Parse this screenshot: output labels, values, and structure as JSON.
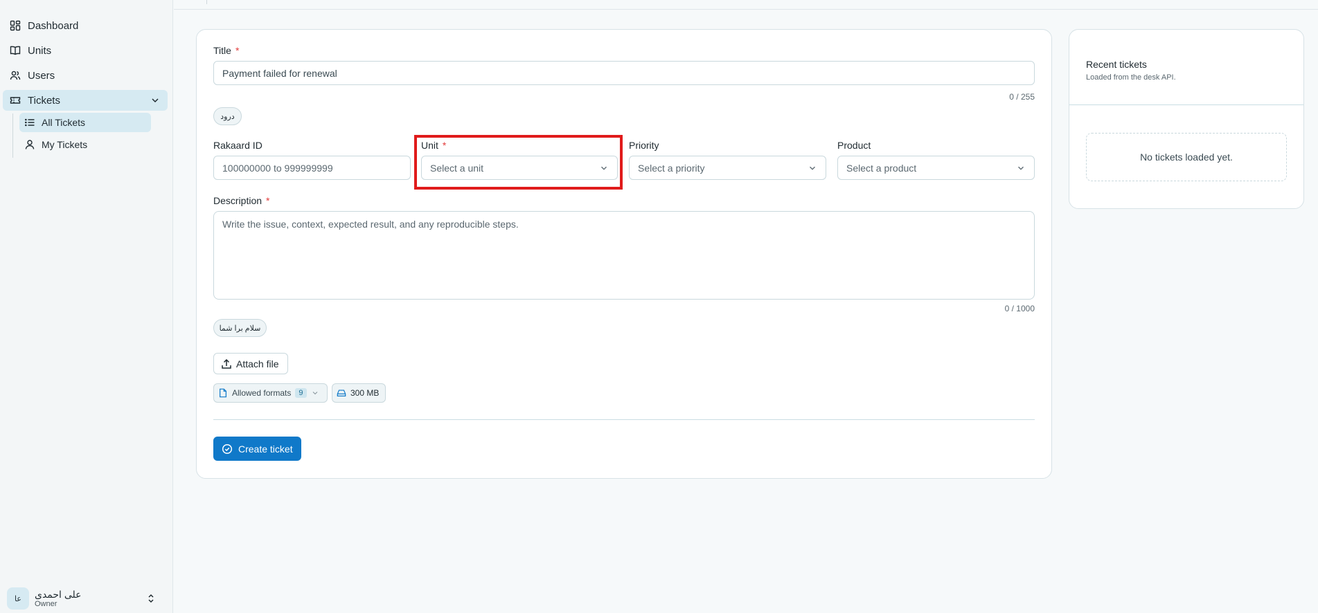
{
  "sidebar": {
    "items": [
      {
        "label": "Dashboard",
        "icon": "dashboard-icon"
      },
      {
        "label": "Units",
        "icon": "book-icon"
      },
      {
        "label": "Users",
        "icon": "users-icon"
      },
      {
        "label": "Tickets",
        "icon": "ticket-icon"
      }
    ],
    "sub_items": [
      {
        "label": "All Tickets",
        "icon": "list-icon"
      },
      {
        "label": "My Tickets",
        "icon": "user-icon"
      }
    ],
    "user": {
      "initials": "عا",
      "name": "علی احمدی",
      "role": "Owner"
    }
  },
  "form": {
    "title_label": "Title",
    "title_value": "Payment failed for renewal",
    "title_counter": "0 / 255",
    "title_chip": "درود",
    "rakaard_label": "Rakaard ID",
    "rakaard_placeholder": "100000000 to 999999999",
    "unit_label": "Unit",
    "unit_placeholder": "Select a unit",
    "priority_label": "Priority",
    "priority_placeholder": "Select a priority",
    "product_label": "Product",
    "product_placeholder": "Select a product",
    "description_label": "Description",
    "description_placeholder": "Write the issue, context, expected result, and any reproducible steps.",
    "description_counter": "0 / 1000",
    "description_chip": "سلام برا شما",
    "required_mark": "*",
    "attach_label": "Attach file",
    "formats_label": "Allowed formats",
    "formats_count": "9",
    "size_label": "300 MB",
    "submit_label": "Create ticket"
  },
  "recent": {
    "title": "Recent tickets",
    "subtitle": "Loaded from the desk API.",
    "empty": "No tickets loaded yet."
  },
  "colors": {
    "accent": "#1079c9",
    "highlight": "#e01b1b",
    "required": "#e23b3b"
  }
}
